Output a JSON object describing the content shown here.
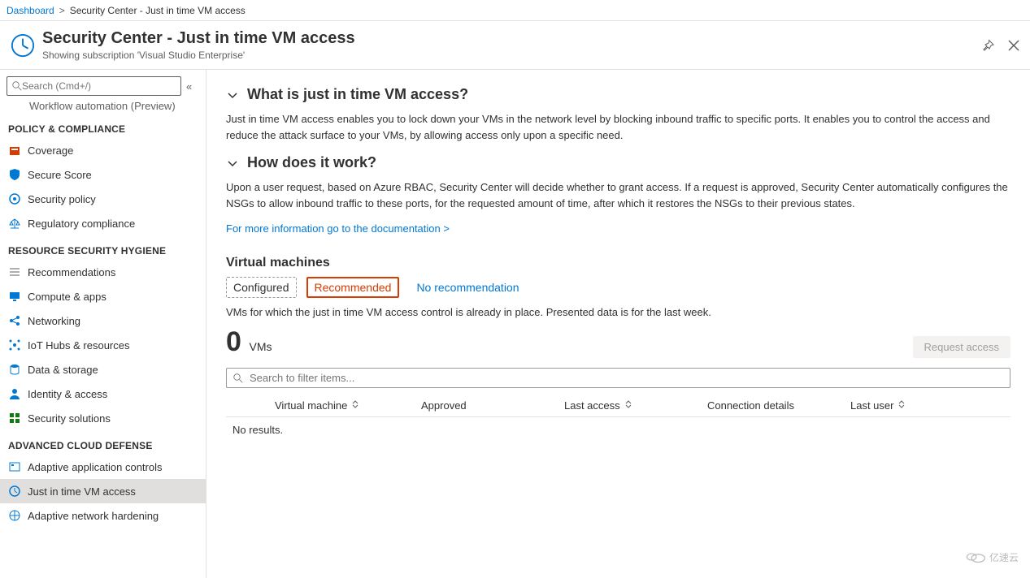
{
  "breadcrumb": {
    "root": "Dashboard",
    "current": "Security Center - Just in time VM access"
  },
  "header": {
    "title": "Security Center - Just in time VM access",
    "subtitle": "Showing subscription 'Visual Studio Enterprise'"
  },
  "sidebar": {
    "search_placeholder": "Search (Cmd+/)",
    "cut_item": "Workflow automation (Preview)",
    "sections": [
      {
        "label": "POLICY & COMPLIANCE",
        "items": [
          {
            "label": "Coverage",
            "icon": "coverage"
          },
          {
            "label": "Secure Score",
            "icon": "shield"
          },
          {
            "label": "Security policy",
            "icon": "policy"
          },
          {
            "label": "Regulatory compliance",
            "icon": "regulatory"
          }
        ]
      },
      {
        "label": "RESOURCE SECURITY HYGIENE",
        "items": [
          {
            "label": "Recommendations",
            "icon": "list"
          },
          {
            "label": "Compute & apps",
            "icon": "compute"
          },
          {
            "label": "Networking",
            "icon": "network"
          },
          {
            "label": "IoT Hubs & resources",
            "icon": "iot"
          },
          {
            "label": "Data & storage",
            "icon": "data"
          },
          {
            "label": "Identity & access",
            "icon": "identity"
          },
          {
            "label": "Security solutions",
            "icon": "tiles"
          }
        ]
      },
      {
        "label": "ADVANCED CLOUD DEFENSE",
        "items": [
          {
            "label": "Adaptive application controls",
            "icon": "adaptive"
          },
          {
            "label": "Just in time VM access",
            "icon": "clock",
            "active": true
          },
          {
            "label": "Adaptive network hardening",
            "icon": "netharden"
          }
        ]
      }
    ]
  },
  "main": {
    "acc1_title": "What is just in time VM access?",
    "acc1_body": "Just in time VM access enables you to lock down your VMs in the network level by blocking inbound traffic to specific ports. It enables you to control the access and reduce the attack surface to your VMs, by allowing access only upon a specific need.",
    "acc2_title": "How does it work?",
    "acc2_body": "Upon a user request, based on Azure RBAC, Security Center will decide whether to grant access. If a request is approved, Security Center automatically configures the NSGs to allow inbound traffic to these ports, for the requested amount of time, after which it restores the NSGs to their previous states.",
    "doc_link": "For more information go to the documentation >",
    "vm_heading": "Virtual machines",
    "tabs": [
      {
        "label": "Configured",
        "state": "selected"
      },
      {
        "label": "Recommended",
        "state": "highlight"
      },
      {
        "label": "No recommendation",
        "state": "plain"
      }
    ],
    "vm_note": "VMs for which the just in time VM access control is already in place. Presented data is for the last week.",
    "count": "0",
    "count_label": "VMs",
    "request_btn": "Request access",
    "filter_placeholder": "Search to filter items...",
    "columns": [
      "Virtual machine",
      "Approved",
      "Last access",
      "Connection details",
      "Last user"
    ],
    "no_results": "No results."
  },
  "watermark": "亿速云"
}
